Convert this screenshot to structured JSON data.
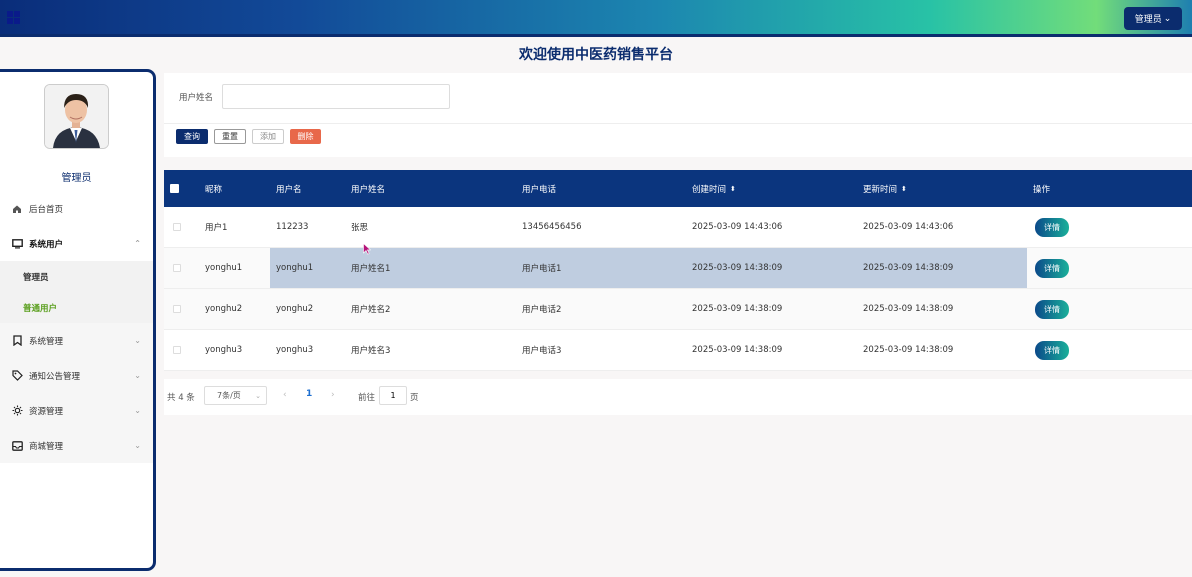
{
  "header": {
    "admin_button": "管理员",
    "admin_chevron": "⌄"
  },
  "welcome_title": "欢迎使用中医药销售平台",
  "sidebar": {
    "user_name": "管理员",
    "items": [
      {
        "label": "后台首页",
        "icon": "home-icon"
      },
      {
        "label": "系统用户",
        "icon": "monitor-icon",
        "expanded": true,
        "children": [
          {
            "label": "管理员"
          },
          {
            "label": "普通用户",
            "active": true
          }
        ]
      },
      {
        "label": "系统管理",
        "icon": "bookmark-icon"
      },
      {
        "label": "通知公告管理",
        "icon": "tag-icon"
      },
      {
        "label": "资源管理",
        "icon": "sun-icon"
      },
      {
        "label": "商城管理",
        "icon": "inbox-icon"
      }
    ]
  },
  "search": {
    "label": "用户姓名",
    "value": "",
    "buttons": {
      "query": "查询",
      "reset": "重置",
      "add": "添加",
      "delete": "删除"
    }
  },
  "table": {
    "columns": [
      "昵称",
      "用户名",
      "用户姓名",
      "用户电话",
      "创建时间",
      "更新时间",
      "操作"
    ],
    "sort_glyph": "⬍",
    "detail_label": "详情",
    "rows": [
      {
        "nickname": "用户1",
        "username": "112233",
        "realname": "张思",
        "phone": "13456456456",
        "created": "2025-03-09 14:43:06",
        "updated": "2025-03-09 14:43:06"
      },
      {
        "nickname": "yonghu1",
        "username": "yonghu1",
        "realname": "用户姓名1",
        "phone": "用户电话1",
        "created": "2025-03-09 14:38:09",
        "updated": "2025-03-09 14:38:09",
        "highlighted": true
      },
      {
        "nickname": "yonghu2",
        "username": "yonghu2",
        "realname": "用户姓名2",
        "phone": "用户电话2",
        "created": "2025-03-09 14:38:09",
        "updated": "2025-03-09 14:38:09"
      },
      {
        "nickname": "yonghu3",
        "username": "yonghu3",
        "realname": "用户姓名3",
        "phone": "用户电话3",
        "created": "2025-03-09 14:38:09",
        "updated": "2025-03-09 14:38:09"
      }
    ]
  },
  "pagination": {
    "total": "共 4 条",
    "page_size": "7条/页",
    "prev": "‹",
    "current_page": "1",
    "next": "›",
    "goto_label": "前往",
    "goto_value": "1",
    "page_suffix": "页"
  },
  "colors": {
    "primary": "#0b2c6e",
    "table_header": "#0b357e",
    "active_sub": "#5ca020",
    "danger": "#e8684a",
    "row_highlight": "#bfcde0"
  }
}
